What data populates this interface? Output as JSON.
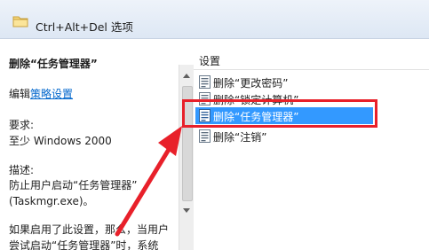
{
  "window": {
    "title": "Ctrl+Alt+Del 选项"
  },
  "description": {
    "title": "删除“任务管理器”",
    "edit_prefix": "编辑",
    "edit_link": "策略设置",
    "requirements_label": "要求:",
    "requirements_value": "至少 Windows 2000",
    "desc_label": "描述:",
    "desc_line1": "防止用户启动“任务管理器”",
    "desc_line2": "(Taskmgr.exe)。",
    "desc_line3": "如果启用了此设置，那么，当用户",
    "desc_line4": "尝试启动“任务管理器”时，系统"
  },
  "list": {
    "column_header": "设置",
    "items": [
      {
        "label": "删除“更改密码”"
      },
      {
        "label": "删除“锁定计算机”"
      },
      {
        "label": "删除“任务管理器”"
      },
      {
        "label": "删除“注销”"
      }
    ],
    "selected_index": 2
  },
  "annotation": {
    "highlight_color": "#e8202a"
  },
  "icons": [
    "folder-icon",
    "policy-doc-icon",
    "scroll-up-icon",
    "scroll-down-icon",
    "red-arrow-annotation"
  ]
}
